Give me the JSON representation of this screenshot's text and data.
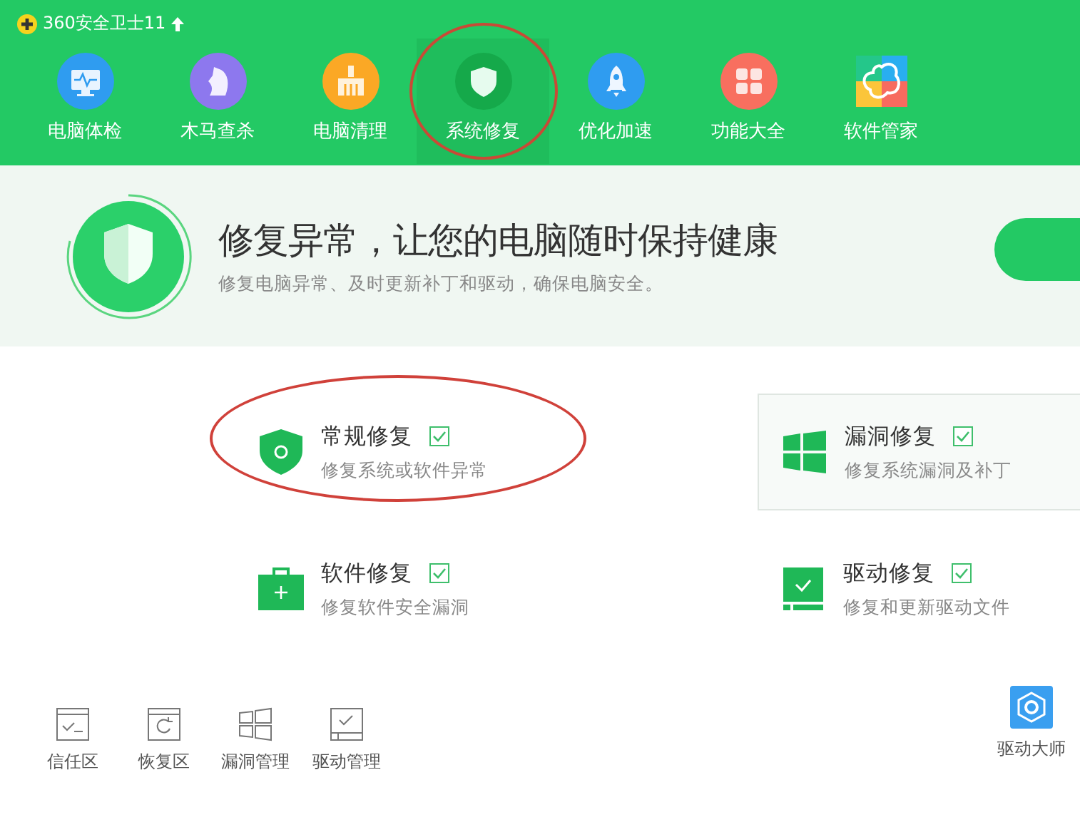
{
  "app": {
    "title": "360安全卫士11"
  },
  "nav": [
    {
      "label": "电脑体检",
      "selected": false,
      "circled": false
    },
    {
      "label": "木马查杀",
      "selected": false,
      "circled": false
    },
    {
      "label": "电脑清理",
      "selected": false,
      "circled": false
    },
    {
      "label": "系统修复",
      "selected": true,
      "circled": true
    },
    {
      "label": "优化加速",
      "selected": false,
      "circled": false
    },
    {
      "label": "功能大全",
      "selected": false,
      "circled": false
    },
    {
      "label": "软件管家",
      "selected": false,
      "circled": false
    }
  ],
  "banner": {
    "title": "修复异常，让您的电脑随时保持健康",
    "subtitle": "修复电脑异常、及时更新补丁和驱动，确保电脑安全。"
  },
  "repairs": [
    {
      "kind": "shield",
      "title": "常规修复",
      "desc": "修复系统或软件异常",
      "checked": true,
      "hovered": false,
      "circled": true
    },
    {
      "kind": "windows",
      "title": "漏洞修复",
      "desc": "修复系统漏洞及补丁",
      "checked": true,
      "hovered": true,
      "circled": false
    },
    {
      "kind": "toolbox",
      "title": "软件修复",
      "desc": "修复软件安全漏洞",
      "checked": true,
      "hovered": false,
      "circled": false
    },
    {
      "kind": "driver",
      "title": "驱动修复",
      "desc": "修复和更新驱动文件",
      "checked": true,
      "hovered": false,
      "circled": false
    }
  ],
  "footer": [
    {
      "kind": "trust",
      "label": "信任区"
    },
    {
      "kind": "restore",
      "label": "恢复区"
    },
    {
      "kind": "windows",
      "label": "漏洞管理"
    },
    {
      "kind": "driver",
      "label": "驱动管理"
    }
  ],
  "footer_right": {
    "label": "驱动大师"
  }
}
